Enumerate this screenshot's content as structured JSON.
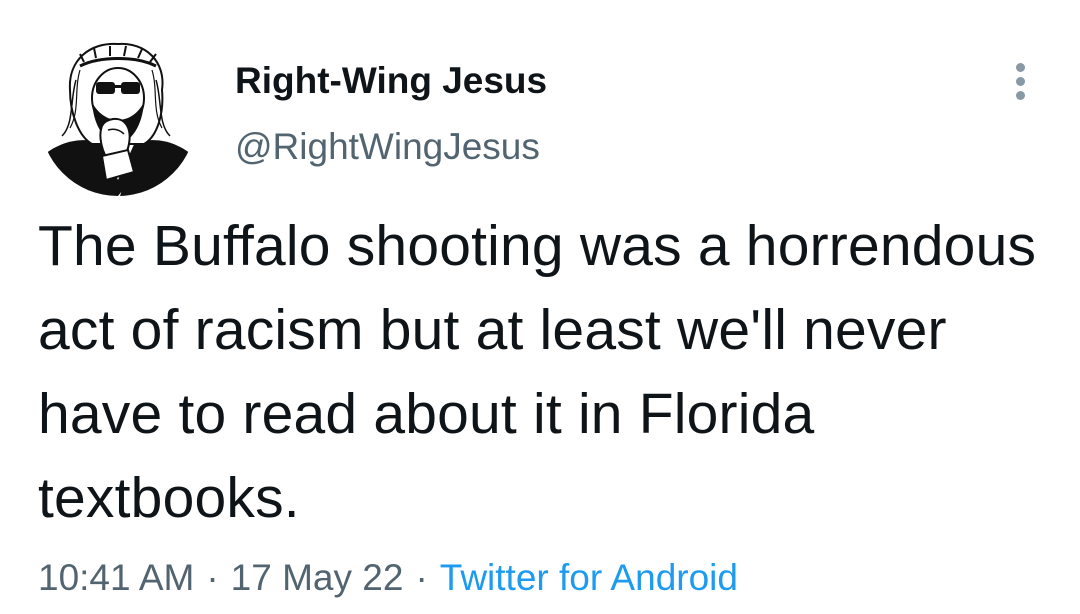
{
  "tweet": {
    "display_name": "Right-Wing Jesus",
    "handle": "@RightWingJesus",
    "text": "The Buffalo shooting was a horrendous act of racism but at least we'll never have to read about it in Florida textbooks.",
    "time": "10:41 AM",
    "date": "17 May 22",
    "separator": "·",
    "source": "Twitter for Android"
  },
  "icons": {
    "avatar": "avatar-illustration",
    "more": "more-options-icon"
  },
  "colors": {
    "text": "#0f1419",
    "secondary": "#536471",
    "link": "#1d9bf0",
    "more_dots": "#8899a6"
  }
}
